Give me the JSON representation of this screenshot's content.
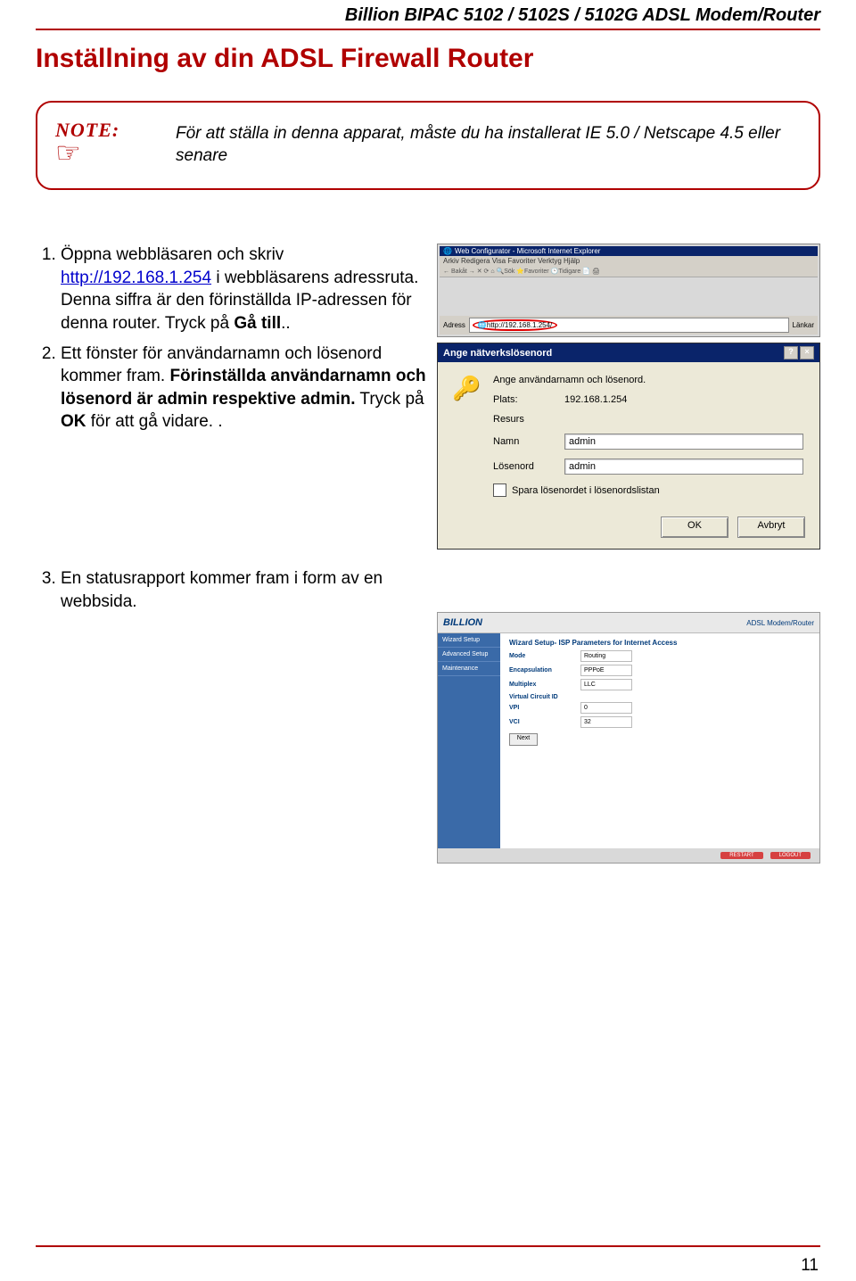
{
  "header": "Billion BIPAC 5102 / 5102S / 5102G ADSL Modem/Router",
  "title": "Inställning av din ADSL Firewall Router",
  "note": {
    "label": "NOTE:",
    "body": "För att ställa in denna apparat, måste du ha installerat IE 5.0 / Netscape 4.5 eller senare"
  },
  "steps": {
    "s1_a": "Öppna webbläsaren och skriv ",
    "s1_link": "http://192.168.1.254",
    "s1_b": " i webbläsarens adressruta. Denna siffra är den förinställda IP-adressen för denna router.    Tryck på ",
    "s1_c": "Gå till",
    "s1_d": "..",
    "s2_a": "Ett fönster för användarnamn och lösenord kommer fram. ",
    "s2_b": "Förinställda användarnamn och lösenord är admin respektive admin.",
    "s2_c": "    Tryck på ",
    "s2_d": "OK",
    "s2_e": " för att gå vidare.  .",
    "s3_a": "En statusrapport kommer fram i form av en webbsida."
  },
  "shot1": {
    "title": "Web Configurator - Microsoft Internet Explorer",
    "menu": "Arkiv   Redigera   Visa   Favoriter   Verktyg   Hjälp",
    "toolbar": "← Bakåt  →  ✕  ⟳  ⌂   🔍Sök  ⭐Favoriter  🕑Tidigare   📄  🖨",
    "address_label": "Adress",
    "address_value": "http://192.168.1.254/",
    "links": "Länkar"
  },
  "dialog": {
    "title": "Ange nätverkslösenord",
    "prompt": "Ange användarnamn och lösenord.",
    "plats_label": "Plats:",
    "plats_value": "192.168.1.254",
    "resurs_label": "Resurs",
    "namn_label": "Namn",
    "namn_value": "admin",
    "losen_label": "Lösenord",
    "losen_value": "admin",
    "spara": "Spara lösenordet i lösenordslistan",
    "ok": "OK",
    "cancel": "Avbryt"
  },
  "router": {
    "logo": "BILLION",
    "header_text": "ADSL Modem/Router",
    "nav": [
      "Wizard Setup",
      "Advanced Setup",
      "Maintenance"
    ],
    "main_title": "Wizard Setup- ISP Parameters for Internet Access",
    "mode_l": "Mode",
    "mode_v": "Routing",
    "encap_l": "Encapsulation",
    "encap_v": "PPPoE",
    "multi_l": "Multiplex",
    "multi_v": "LLC",
    "vcid": "Virtual Circuit ID",
    "vpi_l": "VPI",
    "vpi_v": "0",
    "vci_l": "VCI",
    "vci_v": "32",
    "next": "Next",
    "restart": "RESTART",
    "logout": "LOGOUT"
  },
  "page_number": "11"
}
